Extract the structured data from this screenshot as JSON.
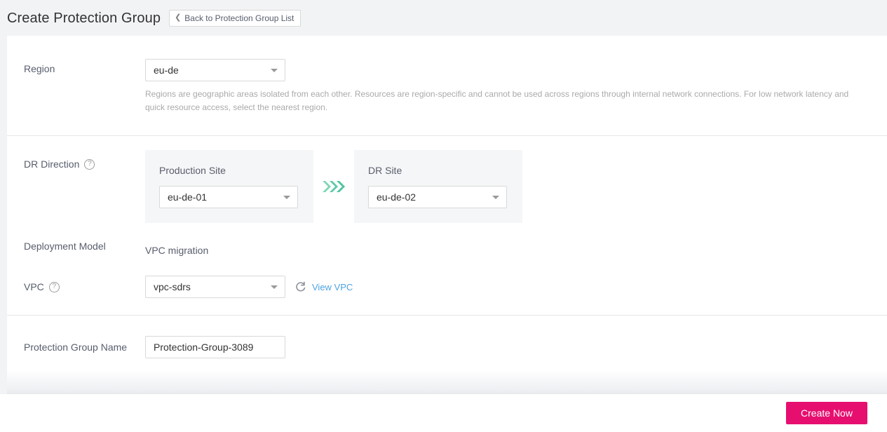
{
  "header": {
    "title": "Create Protection Group",
    "back_button_label": "Back to Protection Group List",
    "back_chevron": "chevron-left-icon"
  },
  "form": {
    "region": {
      "label": "Region",
      "value": "eu-de",
      "description": "Regions are geographic areas isolated from each other. Resources are region-specific and cannot be used across regions through internal network connections. For low network latency and quick resource access, select the nearest region."
    },
    "dr_direction": {
      "label": "DR Direction",
      "help_icon": "question-circle-icon",
      "production_site": {
        "title": "Production Site",
        "value": "eu-de-01"
      },
      "arrow_icon": "triple-chevron-right-icon",
      "dr_site": {
        "title": "DR Site",
        "value": "eu-de-02"
      }
    },
    "deployment_model": {
      "label": "Deployment Model",
      "value": "VPC migration"
    },
    "vpc": {
      "label": "VPC",
      "help_icon": "question-circle-icon",
      "value": "vpc-sdrs",
      "refresh_icon": "refresh-icon",
      "view_link_label": "View VPC"
    },
    "protection_group_name": {
      "label": "Protection Group Name",
      "value": "Protection-Group-3089",
      "placeholder": ""
    }
  },
  "footer": {
    "create_button_label": "Create Now"
  },
  "colors": {
    "accent_button": "#e60f70",
    "link": "#4ea3e0",
    "arrow_teal": "#5fc9a8",
    "page_bg": "#f2f3f5",
    "panel_bg": "#f5f6f7"
  }
}
